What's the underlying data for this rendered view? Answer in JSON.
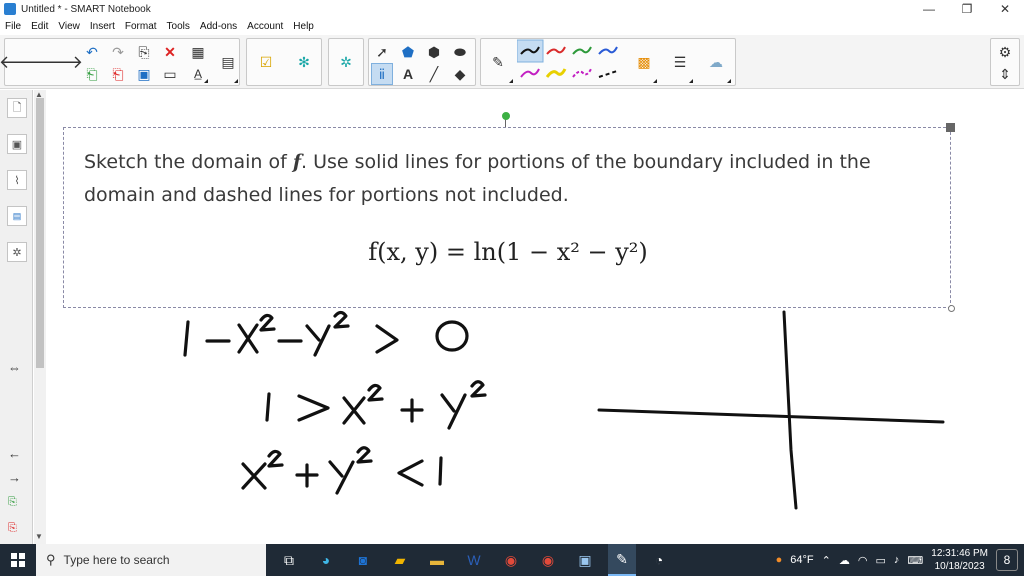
{
  "window": {
    "title": "Untitled * - SMART Notebook",
    "controls": [
      "—",
      "❐",
      "✕"
    ]
  },
  "menu": [
    "File",
    "Edit",
    "View",
    "Insert",
    "Format",
    "Tools",
    "Add-ons",
    "Account",
    "Help"
  ],
  "canvas": {
    "question": {
      "text_before": "Sketch the domain of ",
      "fvar": "f",
      "text_after": ". Use solid lines for portions of the boundary included in the domain and dashed lines for portions not included.",
      "formula": "f(x, y) = ln(1 − x² − y²)"
    },
    "handwriting": [
      "1 − x² − y² > 0",
      "1 > x² + y²",
      "x² + y² < 1"
    ]
  },
  "taskbar": {
    "search_placeholder": "Type here to search",
    "weather": "64°F",
    "time": "12:31:46 PM",
    "date": "10/18/2023",
    "notifications": "8"
  },
  "colors": {
    "accent": "#1f6fc4",
    "selection": "#c5dcf2",
    "taskbar": "#1f2a36",
    "pen_black": "#111111",
    "pen_red": "#d92b2b",
    "pen_green": "#2e9a3b",
    "pen_blue": "#2a5bd6",
    "pen_magenta": "#c21fc2",
    "pen_yellow": "#e8d000"
  }
}
